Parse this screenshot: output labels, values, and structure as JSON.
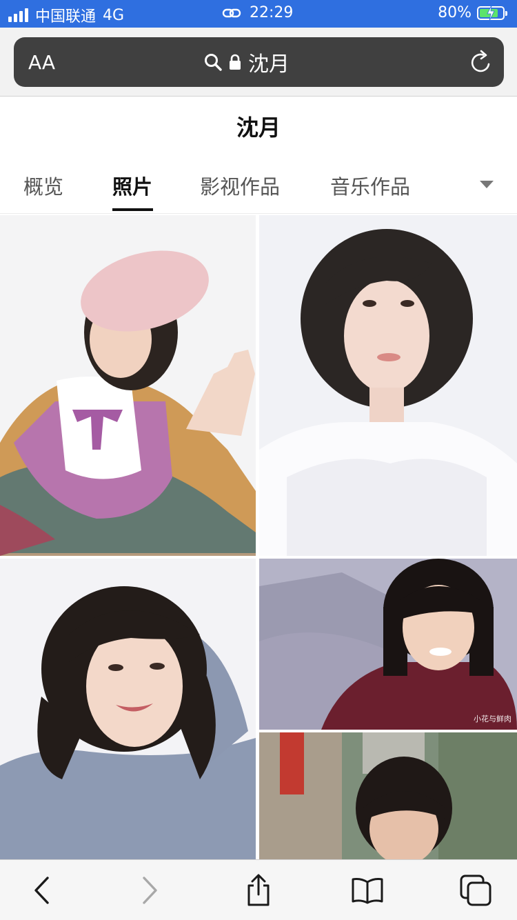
{
  "status_bar": {
    "carrier": "中国联通",
    "network": "4G",
    "time": "22:29",
    "battery": "80%",
    "battery_level": 0.8
  },
  "url_bar": {
    "text_size_label": "AA",
    "address": "沈月"
  },
  "page": {
    "title": "沈月"
  },
  "tabs": [
    {
      "label": "概览",
      "active": false
    },
    {
      "label": "照片",
      "active": true
    },
    {
      "label": "影视作品",
      "active": false
    },
    {
      "label": "音乐作品",
      "active": false
    }
  ],
  "photos": [
    {
      "name": "photo-1",
      "watermark": ""
    },
    {
      "name": "photo-2",
      "watermark": ""
    },
    {
      "name": "photo-3",
      "watermark": ""
    },
    {
      "name": "photo-4",
      "watermark": "小花与鲜肉"
    },
    {
      "name": "photo-5",
      "watermark": ""
    }
  ],
  "toolbar": {
    "icons": [
      "back-icon",
      "forward-icon",
      "share-icon",
      "bookmarks-icon",
      "tabs-icon"
    ]
  },
  "colors": {
    "status_bar": "#2f6fe0",
    "url_bar": "#404040",
    "battery_fill": "#5ce36b",
    "active_tab": "#111111",
    "inactive_tab": "#555555"
  }
}
